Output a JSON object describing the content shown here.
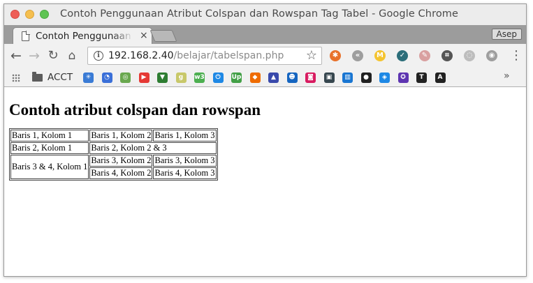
{
  "window": {
    "title": "Contoh Penggunaan Atribut Colspan dan Rowspan Tag Tabel - Google Chrome"
  },
  "tab": {
    "label": "Contoh Penggunaan Atribut Colspan",
    "close": "×"
  },
  "profile": {
    "name": "Asep"
  },
  "toolbar": {
    "url_host": "192.168.2.40",
    "url_path": "/belajar/tabelspan.php",
    "extensions": [
      {
        "icon": "ext-orange-icon",
        "color": "#e8712b",
        "glyph": "✱"
      },
      {
        "icon": "ext-gray-circle-icon",
        "color": "#9e9e9e",
        "glyph": "«"
      },
      {
        "icon": "ext-m-icon",
        "color": "#f4c430",
        "glyph": "M"
      },
      {
        "icon": "ext-check-icon",
        "color": "#2c6e7a",
        "glyph": "✓"
      },
      {
        "icon": "ext-eraser-icon",
        "color": "#d9a0a0",
        "glyph": "✎"
      },
      {
        "icon": "ext-crop-icon",
        "color": "#555555",
        "glyph": "⌗"
      },
      {
        "icon": "ext-sync-icon",
        "color": "#bdbdbd",
        "glyph": "◌"
      },
      {
        "icon": "ext-camera-icon",
        "color": "#9e9e9e",
        "glyph": "◉"
      }
    ]
  },
  "bookmarks": {
    "folder_label": "ACCT",
    "items": [
      {
        "icon": "bm-snowflake-icon",
        "color": "#3a7bd5",
        "glyph": "✳"
      },
      {
        "icon": "bm-spinner-icon",
        "color": "#3a6fd8",
        "glyph": "◔"
      },
      {
        "icon": "bm-chrome-icon",
        "color": "#6aa84f",
        "glyph": "◎"
      },
      {
        "icon": "bm-youtube-icon",
        "color": "#e53935",
        "glyph": "▶"
      },
      {
        "icon": "bm-vue-icon",
        "color": "#2e7d32",
        "glyph": "▼"
      },
      {
        "icon": "bm-g-icon",
        "color": "#c8c86a",
        "glyph": "g"
      },
      {
        "icon": "bm-w3-icon",
        "color": "#4caf50",
        "glyph": "w3"
      },
      {
        "icon": "bm-power-icon",
        "color": "#1e88e5",
        "glyph": "⏻"
      },
      {
        "icon": "bm-up-icon",
        "color": "#43a047",
        "glyph": "Up"
      },
      {
        "icon": "bm-colorful-icon",
        "color": "#ef6c00",
        "glyph": "◆"
      },
      {
        "icon": "bm-arrow-icon",
        "color": "#3949ab",
        "glyph": "▲"
      },
      {
        "icon": "bm-bird-icon",
        "color": "#1565c0",
        "glyph": "☻"
      },
      {
        "icon": "bm-instagram-icon",
        "color": "#d81b60",
        "glyph": "◙"
      },
      {
        "icon": "bm-box-icon",
        "color": "#37474f",
        "glyph": "▣"
      },
      {
        "icon": "bm-trello-icon",
        "color": "#1976d2",
        "glyph": "▥"
      },
      {
        "icon": "bm-record-icon",
        "color": "#212121",
        "glyph": "●"
      },
      {
        "icon": "bm-diamond-icon",
        "color": "#1e88e5",
        "glyph": "◈"
      },
      {
        "icon": "bm-badge-icon",
        "color": "#5e35b1",
        "glyph": "✪"
      },
      {
        "icon": "bm-t-icon",
        "color": "#222222",
        "glyph": "T"
      },
      {
        "icon": "bm-a-icon",
        "color": "#222222",
        "glyph": "A"
      }
    ],
    "more": "»"
  },
  "page": {
    "heading": "Contoh atribut colspan dan rowspan",
    "table": {
      "r1c1": "Baris 1, Kolom 1",
      "r1c2": "Baris 1, Kolom 2",
      "r1c3": "Baris 1, Kolom 3",
      "r2c1": "Baris 2, Kolom 1",
      "r2c23": "Baris 2, Kolom 2 & 3",
      "r34c1": "Baris 3 & 4, Kolom 1",
      "r3c2": "Baris 3, Kolom 2",
      "r3c3": "Baris 3, Kolom 3",
      "r4c2": "Baris 4, Kolom 2",
      "r4c3": "Baris 4, Kolom 3"
    }
  }
}
